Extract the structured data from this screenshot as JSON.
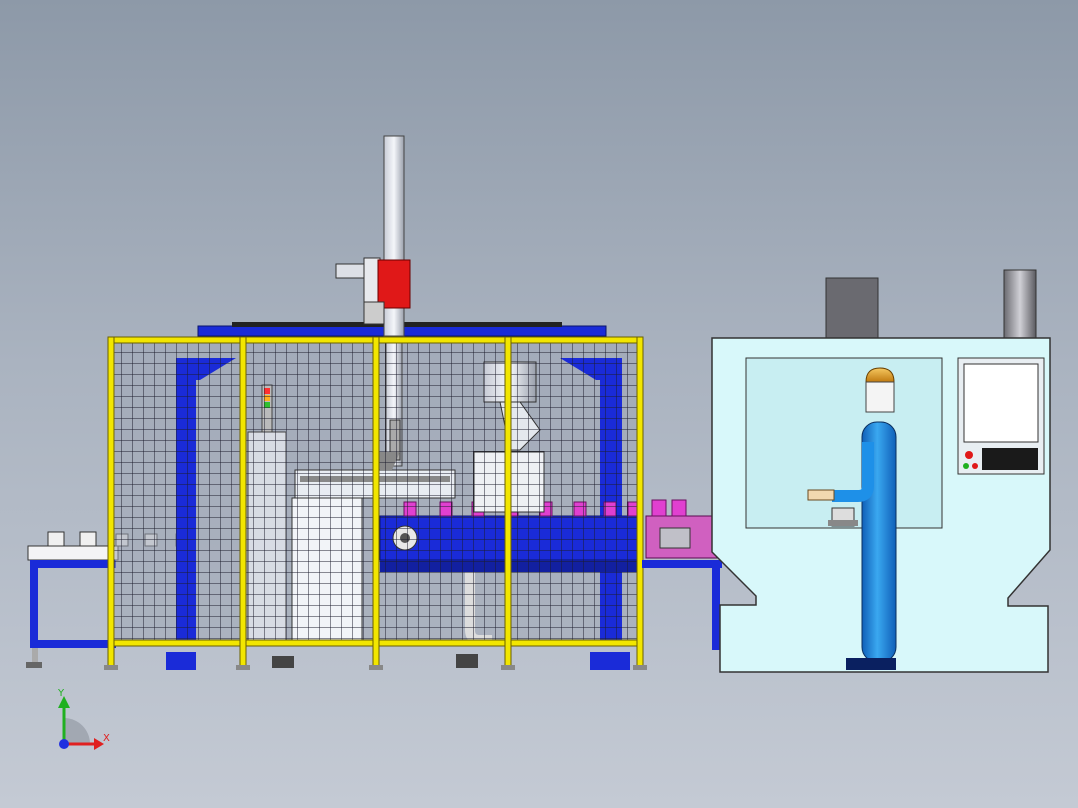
{
  "scene": {
    "description_type": "cad-assembly-view",
    "colors": {
      "background_top": "#8d99a8",
      "background_bottom": "#c4cad4",
      "frame_blue": "#1a2bd8",
      "fence_yellow": "#f2e600",
      "mesh_dark": "#1c1c2c",
      "gripper_red": "#e01818",
      "part_magenta": "#e040d0",
      "cnc_cyan": "#d8f8fa",
      "operator_blue": "#1e90e8",
      "operator_helmet": "#e8a020"
    }
  },
  "axes": {
    "x_label": "X",
    "y_label": "Y"
  }
}
